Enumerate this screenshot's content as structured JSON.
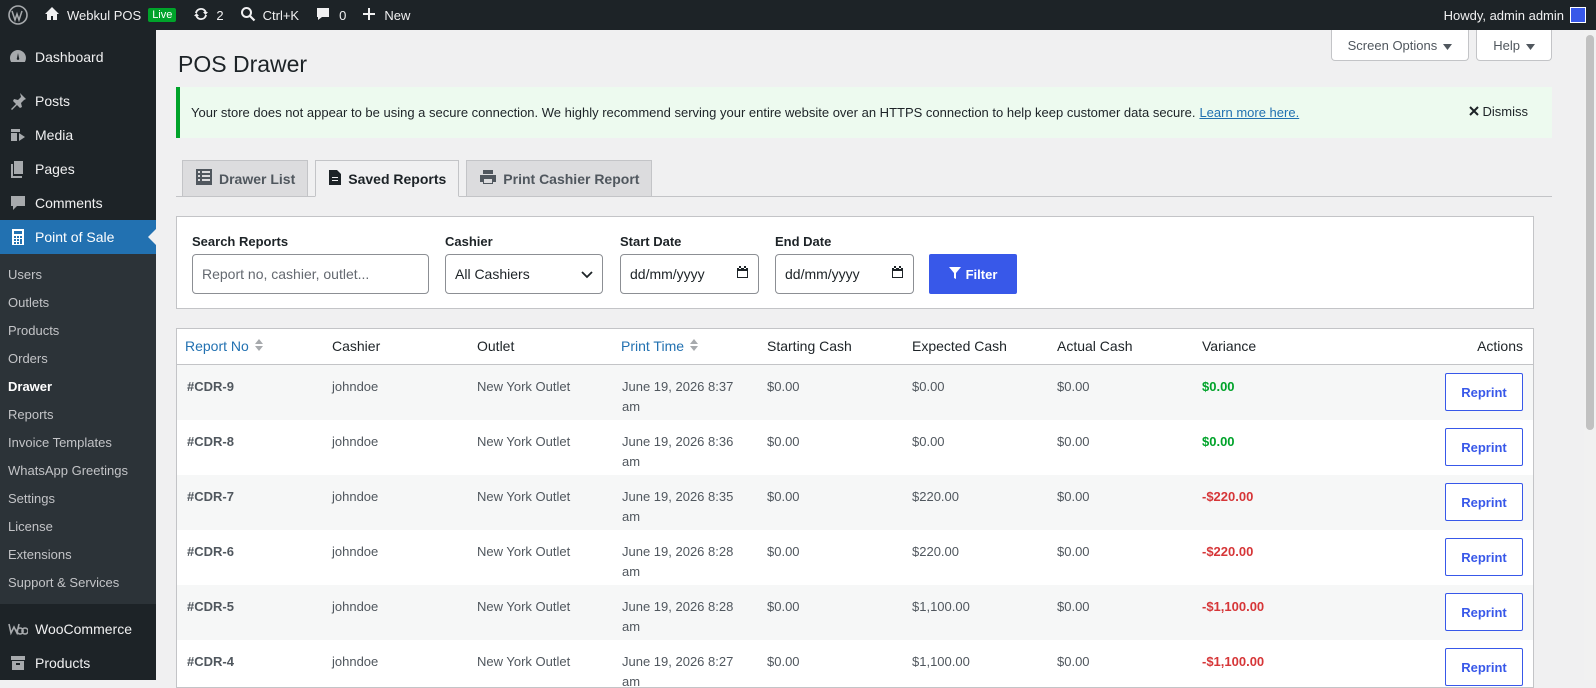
{
  "adminbar": {
    "site_name": "Webkul POS",
    "live_badge": "Live",
    "updates_count": "2",
    "search_shortcut": "Ctrl+K",
    "comments_count": "0",
    "new_label": "New",
    "howdy": "Howdy, admin admin"
  },
  "sidebar": {
    "top_items": [
      {
        "label": "Dashboard"
      },
      {
        "label": "Posts"
      },
      {
        "label": "Media"
      },
      {
        "label": "Pages"
      },
      {
        "label": "Comments"
      },
      {
        "label": "Point of Sale"
      }
    ],
    "sub_items": [
      {
        "label": "Users"
      },
      {
        "label": "Outlets"
      },
      {
        "label": "Products"
      },
      {
        "label": "Orders"
      },
      {
        "label": "Drawer"
      },
      {
        "label": "Reports"
      },
      {
        "label": "Invoice Templates"
      },
      {
        "label": "WhatsApp Greetings"
      },
      {
        "label": "Settings"
      },
      {
        "label": "License"
      },
      {
        "label": "Extensions"
      },
      {
        "label": "Support & Services"
      }
    ],
    "bottom_items": [
      {
        "label": "WooCommerce"
      },
      {
        "label": "Products"
      }
    ]
  },
  "screen_meta": {
    "screen_options": "Screen Options",
    "help": "Help"
  },
  "page": {
    "title": "POS Drawer"
  },
  "notice": {
    "text": "Your store does not appear to be using a secure connection. We highly recommend serving your entire website over an HTTPS connection to help keep customer data secure.",
    "link": "Learn more here.",
    "dismiss": "Dismiss"
  },
  "tabs": [
    {
      "label": "Drawer List"
    },
    {
      "label": "Saved Reports"
    },
    {
      "label": "Print Cashier Report"
    }
  ],
  "filters": {
    "search_label": "Search Reports",
    "search_placeholder": "Report no, cashier, outlet...",
    "cashier_label": "Cashier",
    "cashier_value": "All Cashiers",
    "start_label": "Start Date",
    "start_value": "dd/mm/yyyy",
    "end_label": "End Date",
    "end_value": "dd/mm/yyyy",
    "filter_button": "Filter"
  },
  "table": {
    "headers": {
      "report_no": "Report No",
      "cashier": "Cashier",
      "outlet": "Outlet",
      "print_time": "Print Time",
      "starting_cash": "Starting Cash",
      "expected_cash": "Expected Cash",
      "actual_cash": "Actual Cash",
      "variance": "Variance",
      "actions": "Actions"
    },
    "reprint_label": "Reprint",
    "rows": [
      {
        "report_no": "#CDR-9",
        "cashier": "johndoe",
        "outlet": "New York Outlet",
        "time1": "June 19, 2026 8:37",
        "time2": "am",
        "starting": "$0.00",
        "expected": "$0.00",
        "actual": "$0.00",
        "variance": "$0.00",
        "variance_sign": "pos"
      },
      {
        "report_no": "#CDR-8",
        "cashier": "johndoe",
        "outlet": "New York Outlet",
        "time1": "June 19, 2026 8:36",
        "time2": "am",
        "starting": "$0.00",
        "expected": "$0.00",
        "actual": "$0.00",
        "variance": "$0.00",
        "variance_sign": "pos"
      },
      {
        "report_no": "#CDR-7",
        "cashier": "johndoe",
        "outlet": "New York Outlet",
        "time1": "June 19, 2026 8:35",
        "time2": "am",
        "starting": "$0.00",
        "expected": "$220.00",
        "actual": "$0.00",
        "variance": "-$220.00",
        "variance_sign": "neg"
      },
      {
        "report_no": "#CDR-6",
        "cashier": "johndoe",
        "outlet": "New York Outlet",
        "time1": "June 19, 2026 8:28",
        "time2": "am",
        "starting": "$0.00",
        "expected": "$220.00",
        "actual": "$0.00",
        "variance": "-$220.00",
        "variance_sign": "neg"
      },
      {
        "report_no": "#CDR-5",
        "cashier": "johndoe",
        "outlet": "New York Outlet",
        "time1": "June 19, 2026 8:28",
        "time2": "am",
        "starting": "$0.00",
        "expected": "$1,100.00",
        "actual": "$0.00",
        "variance": "-$1,100.00",
        "variance_sign": "neg"
      },
      {
        "report_no": "#CDR-4",
        "cashier": "johndoe",
        "outlet": "New York Outlet",
        "time1": "June 19, 2026 8:27",
        "time2": "am",
        "starting": "$0.00",
        "expected": "$1,100.00",
        "actual": "$0.00",
        "variance": "-$1,100.00",
        "variance_sign": "neg"
      }
    ]
  },
  "colors": {
    "admin_bar": "#1d2327",
    "accent": "#2271b1",
    "primary_button": "#3858e9",
    "positive": "#00a32a",
    "negative": "#d63638"
  }
}
